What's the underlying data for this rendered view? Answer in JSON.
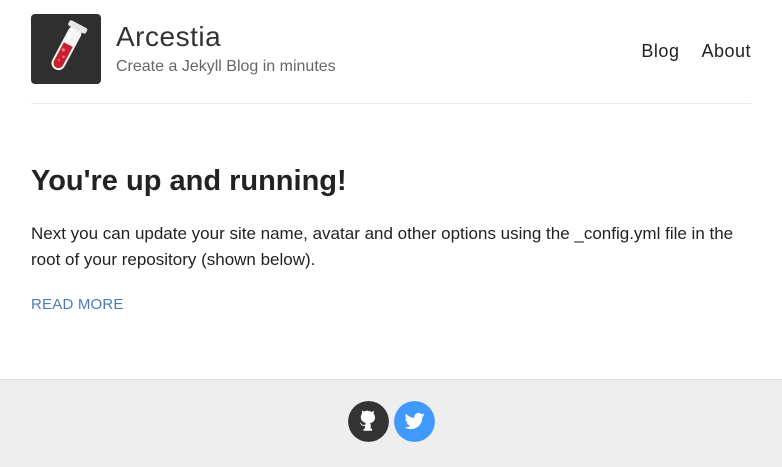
{
  "header": {
    "site_name": "Arcestia",
    "site_description": "Create a Jekyll Blog in minutes",
    "avatar_icon": "test-tube-icon",
    "nav": [
      {
        "label": "Blog"
      },
      {
        "label": "About"
      }
    ]
  },
  "post": {
    "title": "You're up and running!",
    "excerpt": "Next you can update your site name, avatar and other options using the _config.yml file in the root of your repository (shown below).",
    "read_more": "READ MORE"
  },
  "footer": {
    "social": [
      {
        "icon": "github-icon",
        "color": "#333333"
      },
      {
        "icon": "twitter-icon",
        "color": "#4099ff"
      }
    ]
  },
  "colors": {
    "link": "#4a7bbd",
    "footer_bg": "#eeeeee",
    "avatar_bg": "#2f2f2f",
    "tube_liquid": "#c9202f"
  }
}
